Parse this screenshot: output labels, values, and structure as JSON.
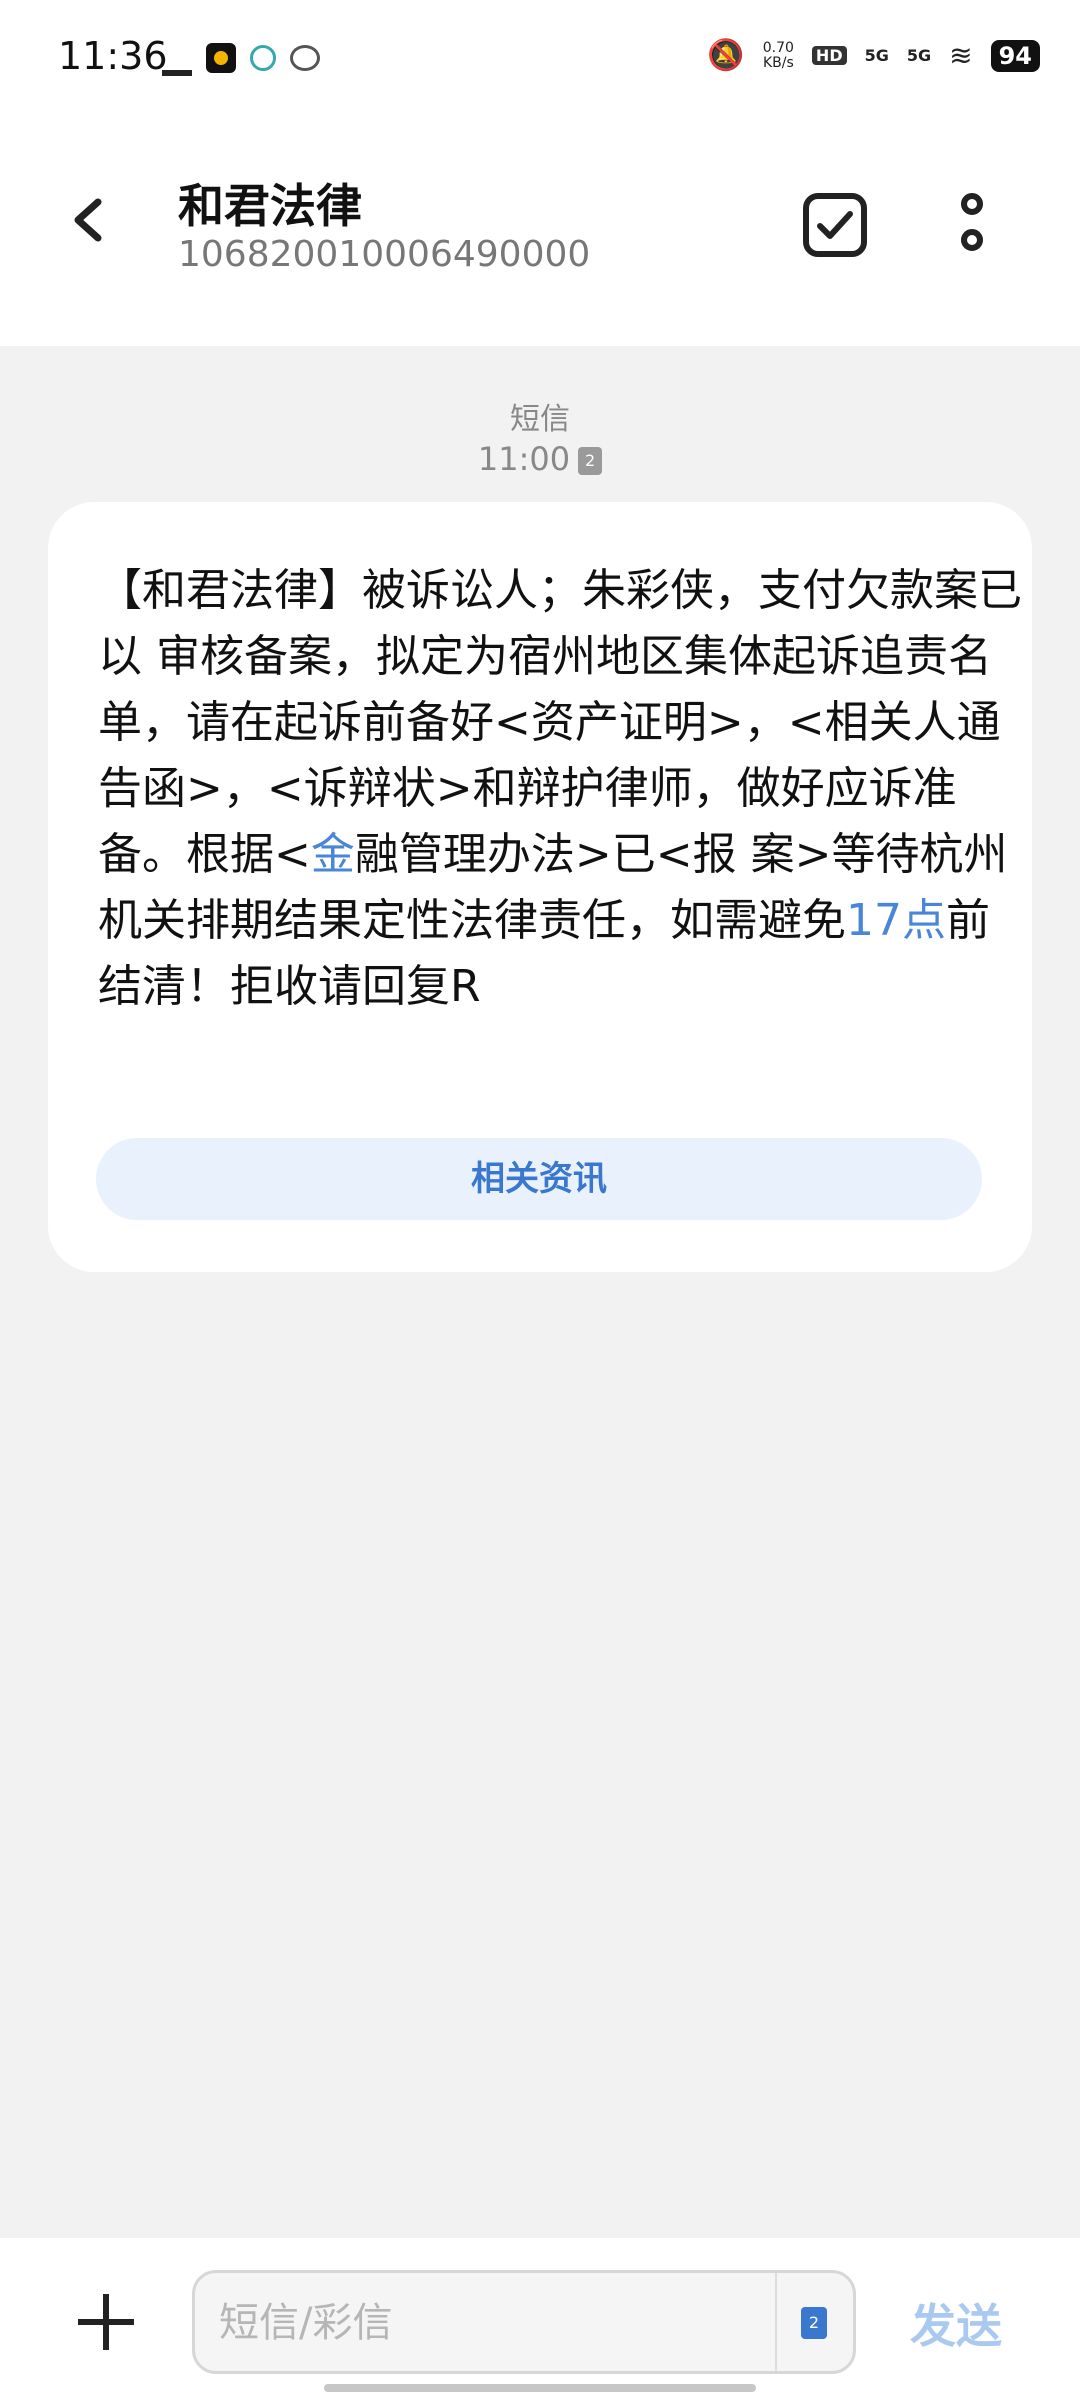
{
  "status_bar": {
    "time": "11:36",
    "net_speed_value": "0.70",
    "net_speed_unit": "KB/s",
    "hd_label": "HD",
    "sig1": "5G",
    "sig2": "5G",
    "battery": "94"
  },
  "header": {
    "title": "和君法律",
    "phone_number": "10682001000649000​0"
  },
  "conversation": {
    "message_type": "短信",
    "message_time": "11:00",
    "sim_badge": "2",
    "message_parts": {
      "p1": "【和君法律】被诉讼人；朱彩侠，支付欠款案已以 审核备案，拟定为宿州地区集体起诉追责名单，请在起诉前备好<资产证明>，<相关人通告函>，<诉辩状>和辩护律师，做好应诉准备。根据<",
      "link1": "金",
      "p2": "融管理办法>已<报 案>等待杭州机关排期结果定性法律责任，如需避免",
      "link2": "17点",
      "p3": "前结清！拒收请回复R"
    },
    "related_button": "相关资讯"
  },
  "composer": {
    "placeholder": "短信/彩信",
    "sim_label": "2",
    "send_label": "发送"
  }
}
